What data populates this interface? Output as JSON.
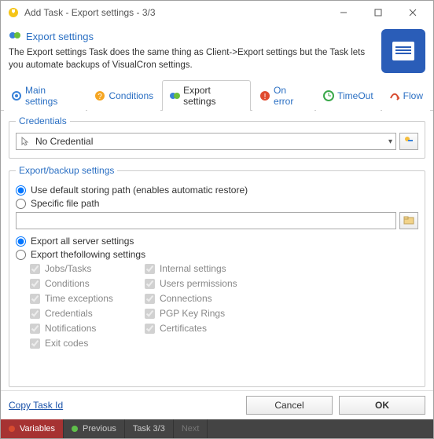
{
  "window": {
    "title": "Add Task - Export settings - 3/3"
  },
  "header": {
    "title": "Export settings",
    "description": "The Export settings Task does the same thing as Client->Export settings but the Task lets you automate backups of VisualCron settings."
  },
  "tabs": {
    "main": "Main settings",
    "conditions": "Conditions",
    "export": "Export settings",
    "onerror": "On error",
    "timeout": "TimeOut",
    "flow": "Flow"
  },
  "credentials": {
    "legend": "Credentials",
    "selected": "No Credential"
  },
  "export": {
    "legend": "Export/backup settings",
    "default_path": "Use default storing path (enables automatic restore)",
    "specific_path": "Specific file path",
    "path_value": "",
    "all_settings": "Export all server settings",
    "following": "Export thefollowing settings",
    "left": [
      "Jobs/Tasks",
      "Conditions",
      "Time exceptions",
      "Credentials",
      "Notifications",
      "Exit codes"
    ],
    "right": [
      "Internal settings",
      "Users permissions",
      "Connections",
      "PGP Key Rings",
      "Certificates"
    ]
  },
  "footer": {
    "copy": "Copy Task Id",
    "cancel": "Cancel",
    "ok": "OK"
  },
  "status": {
    "variables": "Variables",
    "previous": "Previous",
    "task": "Task 3/3",
    "next": "Next"
  }
}
